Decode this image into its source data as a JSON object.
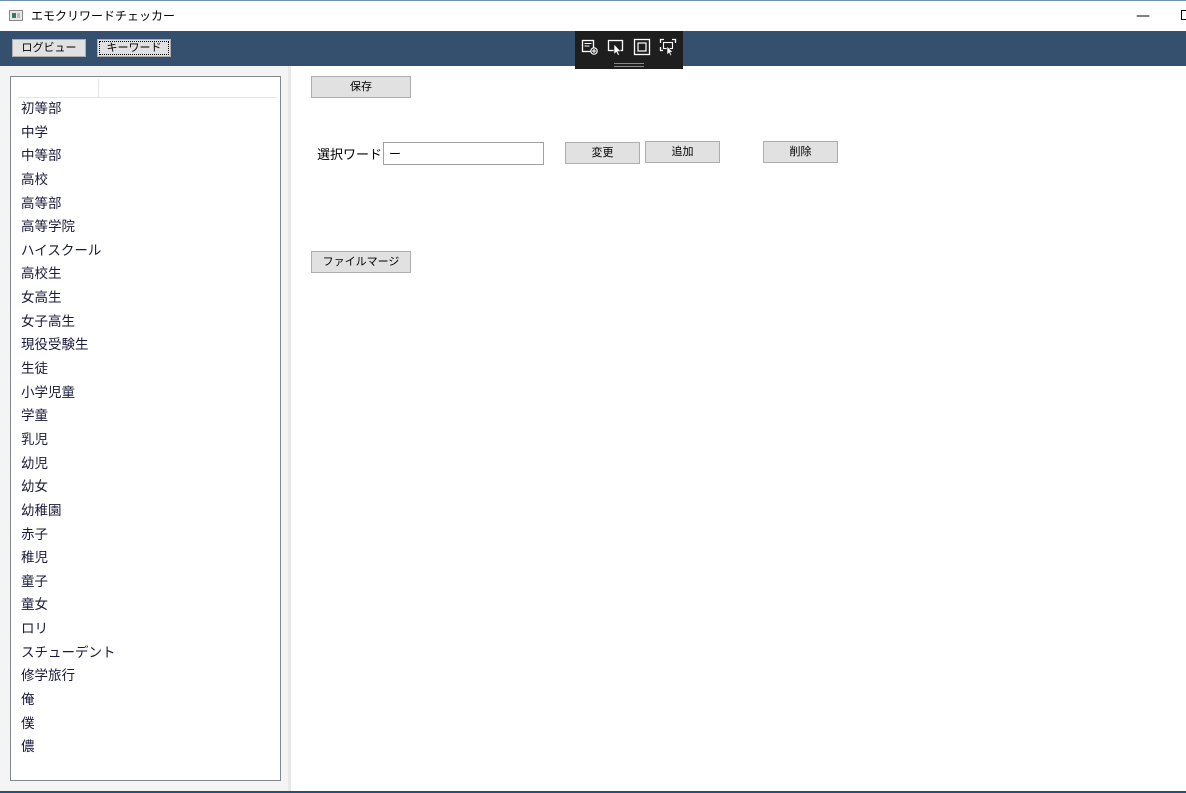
{
  "window": {
    "title": "エモクリワードチェッカー",
    "minimize_glyph": "—"
  },
  "toolbar": {
    "tabs": [
      {
        "label": "ログビュー",
        "active": false
      },
      {
        "label": "キーワード",
        "active": true
      }
    ],
    "accent_color": "#35506e"
  },
  "debug_tools": {
    "icons": [
      "select-element-icon",
      "cursor-select-icon",
      "layout-adorner-icon",
      "track-focus-icon"
    ]
  },
  "keyword_list": {
    "items": [
      "初等部",
      "中学",
      "中等部",
      "高校",
      "高等部",
      "高等学院",
      "ハイスクール",
      "高校生",
      "女高生",
      "女子高生",
      "現役受験生",
      "生徒",
      "小学児童",
      "学童",
      "乳児",
      "幼児",
      "幼女",
      "幼稚園",
      "赤子",
      "稚児",
      "童子",
      "童女",
      "ロリ",
      "スチューデント",
      "修学旅行",
      "俺",
      "僕",
      "儂"
    ]
  },
  "editor": {
    "save_label": "保存",
    "selected_word_label": "選択ワード",
    "selected_word_value": "ー",
    "change_label": "変更",
    "add_label": "追加",
    "delete_label": "削除",
    "file_merge_label": "ファイルマージ"
  }
}
